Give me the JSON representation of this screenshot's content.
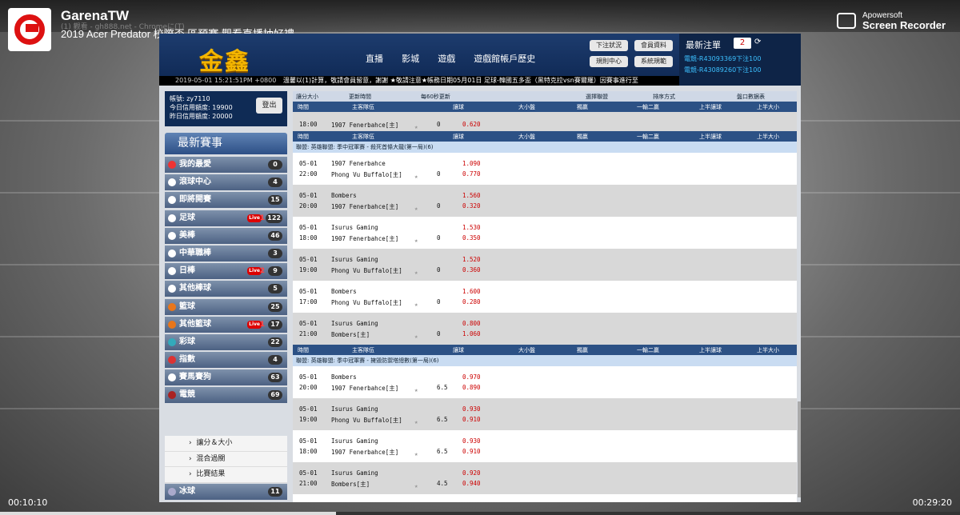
{
  "stream": {
    "channel": "GarenaTW",
    "title": "2019 Acer Predator 校際盃 區預賽 觀看直播抽好禮",
    "ghost_url": "(1) 觀看 - gh888.net - Chromeに(T)",
    "recorder_brand": "Apowersoft",
    "recorder_name": "Screen Recorder",
    "time_elapsed": "00:10:10",
    "time_total": "00:29:20",
    "progress": 0.35
  },
  "site": {
    "brand": "金鑫",
    "nav": [
      "直播",
      "影城",
      "遊戲",
      "遊戲館帳戶歷史"
    ],
    "header_buttons": [
      "下注狀況",
      "會員資料",
      "規則中心",
      "系統規範"
    ],
    "ticker_time": "2019-05-01 15:21:51PM +0800",
    "ticker_text": "溫馨以(1)計算，敬請會員留意，謝謝 ★敬請注意★帳務日期05月01日 足球-韓國五多盃（黑特克拉vsn賽爾羅）因賽事進行至",
    "bet_panel": {
      "label": "最新注單",
      "count": "2",
      "refresh_icon": "refresh-icon",
      "bets": [
        "電競-R43093369下注100",
        "電競-R43089260下注100"
      ]
    },
    "account": {
      "user": "帳號: zy7110",
      "today": "今日信用額度: 19900",
      "yesterday": "昨日信用額度: 20000",
      "logout": "登出"
    },
    "sidebar_title": "最新賽事",
    "sidebar": [
      {
        "label": "我的最愛",
        "count": "0",
        "icon": "heart-icon",
        "color": "#e33"
      },
      {
        "label": "滾球中心",
        "count": "4",
        "icon": "shield-icon",
        "color": "#fff"
      },
      {
        "label": "即將開賽",
        "count": "15",
        "icon": "shield-icon",
        "color": "#fff"
      },
      {
        "label": "足球",
        "count": "122",
        "icon": "soccer-ball-icon",
        "color": "#fff",
        "live": "Live",
        "live_count": "1"
      },
      {
        "label": "美棒",
        "count": "46",
        "icon": "baseball-icon",
        "color": "#fff"
      },
      {
        "label": "中華職棒",
        "count": "3",
        "icon": "baseball-icon",
        "color": "#fff"
      },
      {
        "label": "日棒",
        "count": "9",
        "icon": "baseball-icon",
        "color": "#fff",
        "live": "Live",
        "live_count": "2"
      },
      {
        "label": "其他棒球",
        "count": "5",
        "icon": "baseball-icon",
        "color": "#fff"
      },
      {
        "label": "籃球",
        "count": "25",
        "icon": "basketball-icon",
        "color": "#e8761b"
      },
      {
        "label": "其他籃球",
        "count": "17",
        "icon": "basketball-icon",
        "color": "#e8761b",
        "live": "Live",
        "live_count": "1"
      },
      {
        "label": "彩球",
        "count": "22",
        "icon": "lottery-ball-icon",
        "color": "#3ab"
      },
      {
        "label": "指數",
        "count": "4",
        "icon": "trend-icon",
        "color": "#d33"
      },
      {
        "label": "賽馬賽狗",
        "count": "63",
        "icon": "shield-icon",
        "color": "#fff"
      },
      {
        "label": "電競",
        "count": "69",
        "icon": "esports-icon",
        "color": "#a22"
      }
    ],
    "esports_sub": [
      "讓分＆大小",
      "混合過關",
      "比賽結果"
    ],
    "icehockey": {
      "label": "冰球",
      "count": "11",
      "icon": "ice-hockey-icon"
    },
    "toolbar": [
      "讓分大小",
      "更新時間",
      "每60秒更新",
      "選擇聯盟",
      "排序方式",
      "盤口數据表"
    ],
    "col_headers": [
      "時間",
      "主客隊伍",
      "讓球",
      "大小盤",
      "獨贏",
      "一輸二贏",
      "上半讓球",
      "上半大小"
    ],
    "leagues": [
      {
        "name": "聯盟: 英雄聯盟: 季中冠軍賽 - 殺死首條大龍(第一局)(6)"
      },
      {
        "name": "聯盟: 英雄聯盟: 季中冠軍賽 - 擁毀防禦塔總數(第一局)(6)"
      }
    ],
    "top_row": {
      "date": "",
      "time": "18:00",
      "home": "",
      "away": "1907 Fenerbahce[主]",
      "hcp": "0",
      "o1": "",
      "o2": "0.620"
    },
    "matches_1": [
      {
        "date": "05-01",
        "time": "22:00",
        "home": "1907 Fenerbahce",
        "away": "Phong Vu Buffalo[主]",
        "hcp": "0",
        "o1": "1.090",
        "o2": "0.770"
      },
      {
        "date": "05-01",
        "time": "20:00",
        "home": "Bombers",
        "away": "1907 Fenerbahce[主]",
        "hcp": "0",
        "o1": "1.560",
        "o2": "0.320"
      },
      {
        "date": "05-01",
        "time": "18:00",
        "home": "Isurus Gaming",
        "away": "1907 Fenerbahce[主]",
        "hcp": "0",
        "o1": "1.530",
        "o2": "0.350"
      },
      {
        "date": "05-01",
        "time": "19:00",
        "home": "Isurus Gaming",
        "away": "Phong Vu Buffalo[主]",
        "hcp": "0",
        "o1": "1.520",
        "o2": "0.360"
      },
      {
        "date": "05-01",
        "time": "17:00",
        "home": "Bombers",
        "away": "Phong Vu Buffalo[主]",
        "hcp": "0",
        "o1": "1.600",
        "o2": "0.280"
      },
      {
        "date": "05-01",
        "time": "21:00",
        "home": "Isurus Gaming",
        "away": "Bombers[主]",
        "hcp": "0",
        "o1": "0.800",
        "o2": "1.060"
      }
    ],
    "matches_2": [
      {
        "date": "05-01",
        "time": "20:00",
        "home": "Bombers",
        "away": "1907 Fenerbahce[主]",
        "hcp": "6.5",
        "o1": "0.970",
        "o2": "0.890"
      },
      {
        "date": "05-01",
        "time": "19:00",
        "home": "Isurus Gaming",
        "away": "Phong Vu Buffalo[主]",
        "hcp": "6.5",
        "o1": "0.930",
        "o2": "0.910"
      },
      {
        "date": "05-01",
        "time": "18:00",
        "home": "Isurus Gaming",
        "away": "1907 Fenerbahce[主]",
        "hcp": "6.5",
        "o1": "0.930",
        "o2": "0.910"
      },
      {
        "date": "05-01",
        "time": "21:00",
        "home": "Isurus Gaming",
        "away": "Bombers[主]",
        "hcp": "4.5",
        "o1": "0.920",
        "o2": "0.940"
      }
    ]
  }
}
